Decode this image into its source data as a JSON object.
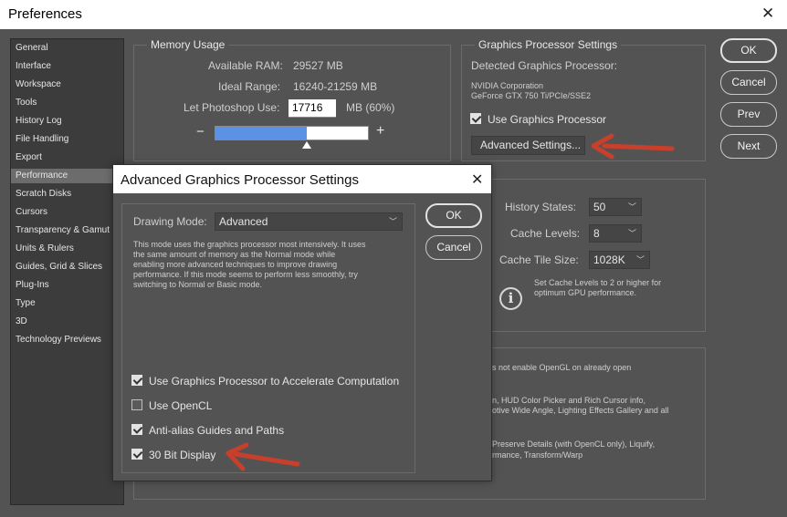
{
  "window": {
    "title": "Preferences",
    "close_glyph": "✕"
  },
  "sidebar": {
    "items": [
      {
        "label": "General"
      },
      {
        "label": "Interface"
      },
      {
        "label": "Workspace"
      },
      {
        "label": "Tools"
      },
      {
        "label": "History Log"
      },
      {
        "label": "File Handling"
      },
      {
        "label": "Export"
      },
      {
        "label": "Performance",
        "selected": true
      },
      {
        "label": "Scratch Disks"
      },
      {
        "label": "Cursors"
      },
      {
        "label": "Transparency & Gamut"
      },
      {
        "label": "Units & Rulers"
      },
      {
        "label": "Guides, Grid & Slices"
      },
      {
        "label": "Plug-Ins"
      },
      {
        "label": "Type"
      },
      {
        "label": "3D"
      },
      {
        "label": "Technology Previews"
      }
    ]
  },
  "memory": {
    "title": "Memory Usage",
    "available_label": "Available RAM:",
    "available_value": "29527 MB",
    "ideal_label": "Ideal Range:",
    "ideal_value": "16240-21259 MB",
    "let_label": "Let Photoshop Use:",
    "let_value": "17716",
    "let_unit": "MB (60%)",
    "minus": "−",
    "plus": "+",
    "slider_fraction": 0.6
  },
  "gpu": {
    "title": "Graphics Processor Settings",
    "detected_label": "Detected Graphics Processor:",
    "vendor": "NVIDIA Corporation",
    "model": "GeForce GTX 750 Ti/PCIe/SSE2",
    "use_gpu_label": "Use Graphics Processor",
    "use_gpu_checked": true,
    "advanced_button": "Advanced Settings..."
  },
  "buttons": {
    "ok": "OK",
    "cancel": "Cancel",
    "prev": "Prev",
    "next": "Next"
  },
  "history": {
    "states_label": "History States:",
    "states_value": "50",
    "levels_label": "Cache Levels:",
    "levels_value": "8",
    "tile_label": "Cache Tile Size:",
    "tile_value": "1028K",
    "tip_line1": "Set Cache Levels to 2 or higher for",
    "tip_line2": "optimum GPU performance.",
    "info_glyph": "i"
  },
  "description": {
    "line1": "s not enable OpenGL on already open",
    "line2": "n, HUD Color Picker and Rich Cursor info,",
    "line3": "otive Wide Angle, Lighting Effects Gallery and all",
    "line4": "Preserve Details (with OpenCL only), Liquify,",
    "line5": "rmance, Transform/Warp"
  },
  "dialog": {
    "title": "Advanced Graphics Processor Settings",
    "close_glyph": "✕",
    "drawing_mode_label": "Drawing Mode:",
    "drawing_mode_value": "Advanced",
    "desc_line1": "This mode uses the graphics processor most intensively.  It uses",
    "desc_line2": "the same amount of memory as the Normal mode while",
    "desc_line3": "enabling more advanced techniques to improve drawing",
    "desc_line4": "performance.  If this mode seems to perform less smoothly, try",
    "desc_line5": "switching to Normal or Basic mode.",
    "ok": "OK",
    "cancel": "Cancel",
    "options": [
      {
        "label": "Use Graphics Processor to Accelerate Computation",
        "checked": true
      },
      {
        "label": "Use OpenCL",
        "checked": false
      },
      {
        "label": "Anti-alias Guides and Paths",
        "checked": true
      },
      {
        "label": "30 Bit Display",
        "checked": true
      }
    ]
  },
  "colors": {
    "background": "#535353",
    "sidebar_bg": "#3c3c3c",
    "slider_fill": "#5b92e5",
    "annotation_arrow": "#c8402c"
  }
}
